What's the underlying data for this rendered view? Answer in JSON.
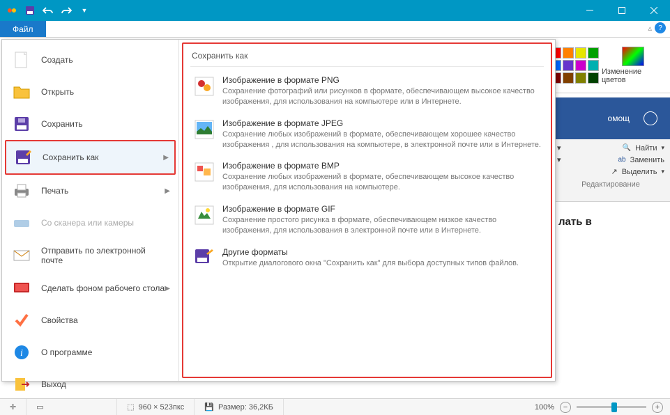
{
  "titlebar": {
    "file_tab": "Файл"
  },
  "menu": {
    "items": [
      {
        "label": "Создать"
      },
      {
        "label": "Открыть"
      },
      {
        "label": "Сохранить"
      },
      {
        "label": "Сохранить как"
      },
      {
        "label": "Печать"
      },
      {
        "label": "Со сканера или камеры"
      },
      {
        "label": "Отправить по электронной почте"
      },
      {
        "label": "Сделать фоном рабочего стола"
      },
      {
        "label": "Свойства"
      },
      {
        "label": "О программе"
      },
      {
        "label": "Выход"
      }
    ],
    "submenu_title": "Сохранить как",
    "formats": [
      {
        "title": "Изображение в формате PNG",
        "desc": "Сохранение фотографий или рисунков в формате, обеспечивающем высокое качество изображения, для использования на компьютере или в Интернете."
      },
      {
        "title": "Изображение в формате JPEG",
        "desc": "Сохранение любых изображений в формате, обеспечивающем хорошее качество изображения , для использования на компьютере, в электронной почте или в Интернете."
      },
      {
        "title": "Изображение в формате BMP",
        "desc": "Сохранение любых изображений в формате, обеспечивающем высокое качество изображения, для использования на компьютере."
      },
      {
        "title": "Изображение в формате GIF",
        "desc": "Сохранение простого рисунка в формате, обеспечивающем низкое качество изображения, для использования в электронной почте или в Интернете."
      },
      {
        "title": "Другие форматы",
        "desc": "Открытие диалогового окна \"Сохранить как\" для выбора доступных типов файлов."
      }
    ]
  },
  "ribbon": {
    "edit_colors": "Изменение цветов",
    "colors": [
      "#ff0000",
      "#ff8000",
      "#e6e600",
      "#00a000",
      "#0066ff",
      "#6633cc",
      "#cc00cc",
      "#00b0b0",
      "#800000",
      "#804000",
      "#808000",
      "#004000"
    ]
  },
  "word": {
    "help_tab": "омощ",
    "find": "Найти",
    "replace": "Заменить",
    "select": "Выделить",
    "group": "Редактирование",
    "doc_fragment": "лать в"
  },
  "status": {
    "dims": "960 × 523пкс",
    "size": "Размер: 36,2КБ",
    "zoom": "100%"
  }
}
